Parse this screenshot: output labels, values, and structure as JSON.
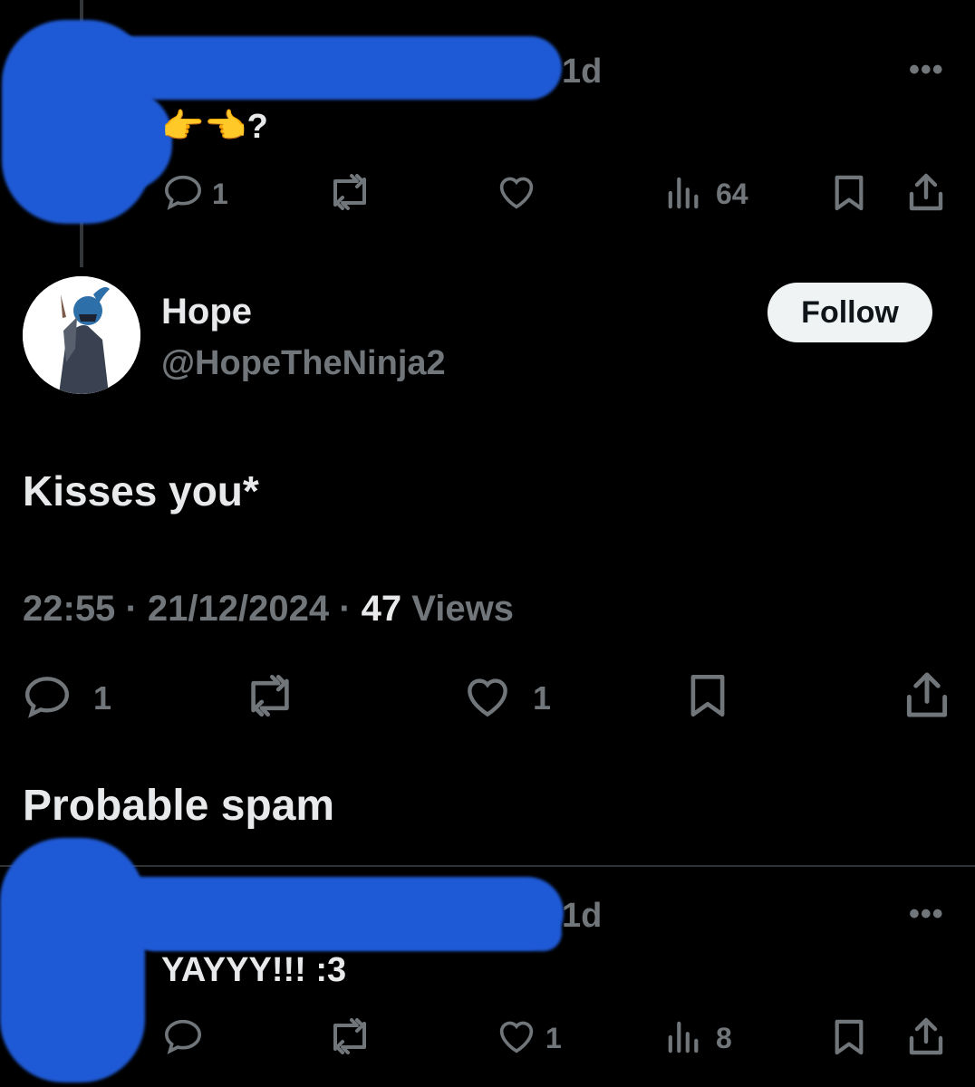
{
  "reply_top": {
    "time": "1d",
    "more_label": "•••",
    "text": "👉👈?",
    "reply_count": "1",
    "views_count": "64"
  },
  "main_tweet": {
    "name": "Hope",
    "handle": "@HopeTheNinja2",
    "follow_label": "Follow",
    "text": "Kisses you*",
    "time": "22:55",
    "date": "21/12/2024",
    "views_count": "47",
    "views_label": "Views",
    "reply_count": "1",
    "like_count": "1"
  },
  "spam_section": {
    "title": "Probable spam"
  },
  "reply_bottom": {
    "time": "1d",
    "more_label": "•••",
    "text": "YAYYY!!! :3",
    "like_count": "1",
    "views_count": "8"
  },
  "colors": {
    "background": "#000000",
    "text": "#e7e9ea",
    "muted": "#71767b",
    "follow_bg": "#eff3f4",
    "redaction": "#1f5ad6"
  },
  "icons": [
    "reply-icon",
    "retweet-icon",
    "like-icon",
    "views-icon",
    "bookmark-icon",
    "share-icon",
    "more-icon"
  ]
}
